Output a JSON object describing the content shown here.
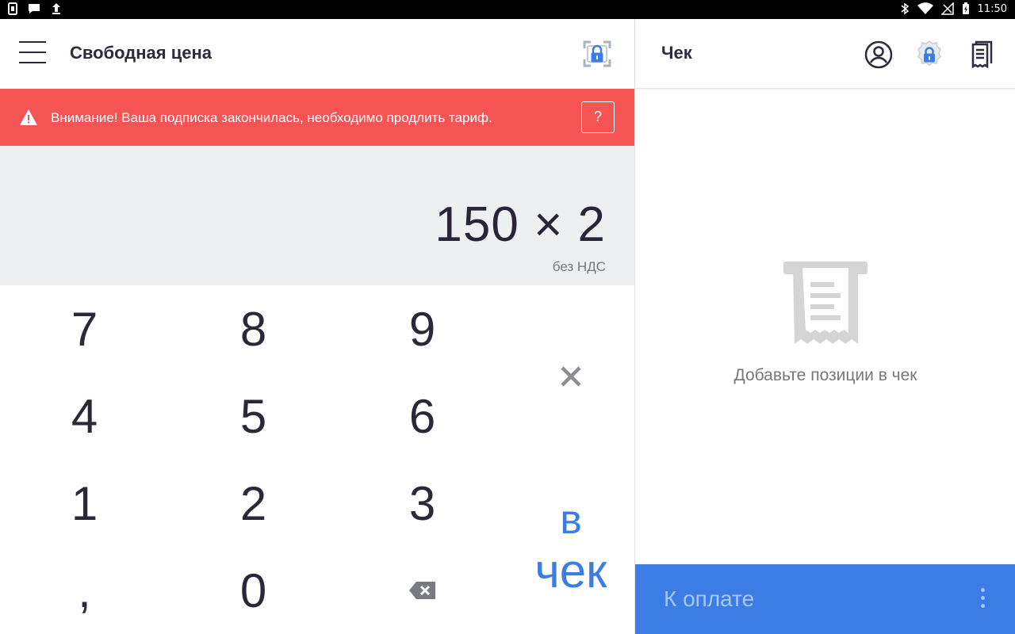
{
  "status_bar": {
    "time": "11:50",
    "icons": [
      "sim-card-icon",
      "chat-icon",
      "upload-icon",
      "bluetooth-icon",
      "wifi-icon",
      "signal-off-icon",
      "battery-icon"
    ]
  },
  "free_price": {
    "title": "Свободная цена",
    "alert": {
      "message": "Внимание! Ваша подписка закончилась, необходимо продлить тариф.",
      "help_label": "?"
    },
    "display": {
      "expression": "150 × 2",
      "vat": "без НДС"
    },
    "keys": {
      "k7": "7",
      "k8": "8",
      "k9": "9",
      "k4": "4",
      "k5": "5",
      "k6": "6",
      "k1": "1",
      "k2": "2",
      "k3": "3",
      "comma": ",",
      "k0": "0"
    },
    "to_check": {
      "line1": "в",
      "line2": "чек"
    }
  },
  "receipt": {
    "title": "Чек",
    "empty_hint": "Добавьте позиции в чек",
    "pay_label": "К оплате"
  },
  "colors": {
    "alert": "#f45454",
    "accent": "#3b7de4",
    "display_bg": "#eeeff1"
  }
}
